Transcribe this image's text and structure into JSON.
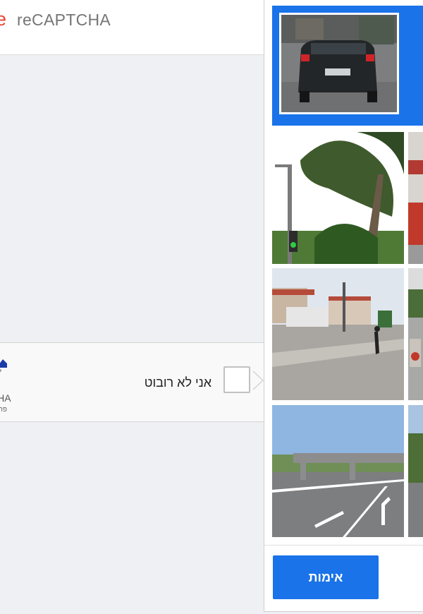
{
  "brand": {
    "name": "reCAPTCHA",
    "mark": "e"
  },
  "widget": {
    "checkbox_label": "אני לא רובוט",
    "logo_text": "CHA",
    "logo_subtext": "פרט"
  },
  "challenge": {
    "verify_label": "אימות",
    "reference_image": "car-rear-on-street",
    "tiles": [
      {
        "subject": "tree-and-traffic-light",
        "position": "row-1-col-1"
      },
      {
        "subject": "street-storefront",
        "position": "row-1-col-2"
      },
      {
        "subject": "intersection-with-pedestrian",
        "position": "row-2-col-1"
      },
      {
        "subject": "road-with-scooter",
        "position": "row-2-col-2"
      },
      {
        "subject": "highway-overpass",
        "position": "row-3-col-1"
      },
      {
        "subject": "roadside-greenery",
        "position": "row-3-col-2"
      }
    ]
  },
  "colors": {
    "accent": "#1a73e8",
    "brand_red": "#e94235"
  }
}
